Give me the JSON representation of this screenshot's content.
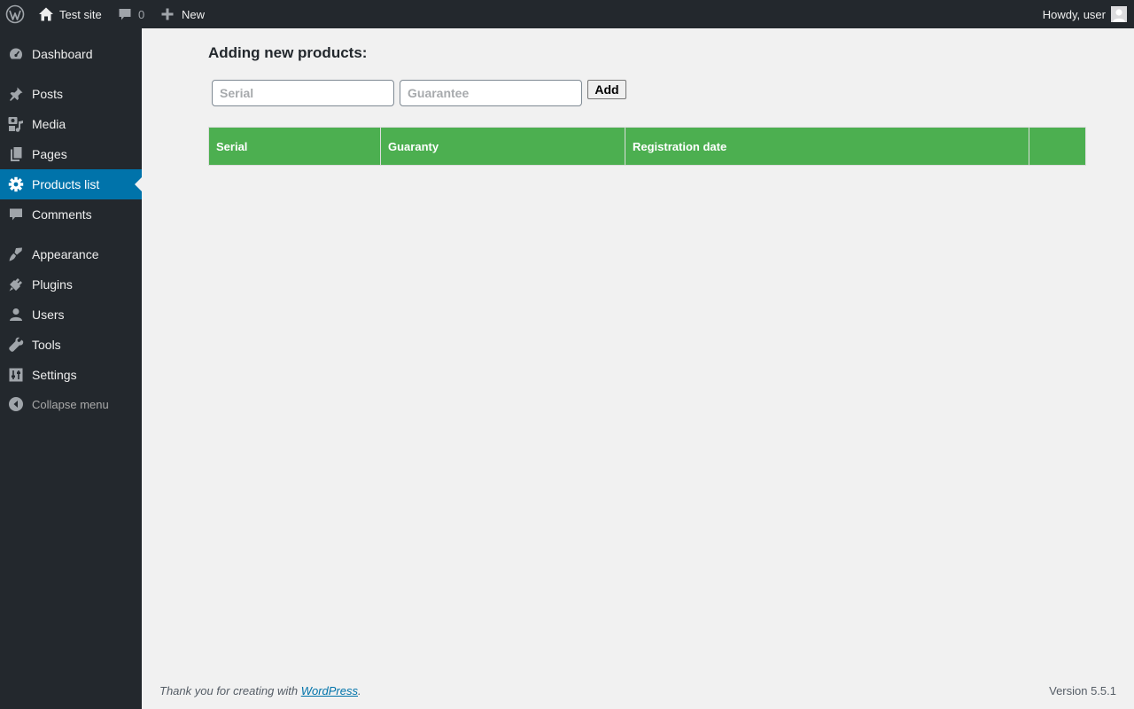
{
  "admin_bar": {
    "site_name": "Test site",
    "comments_count": "0",
    "new_label": "New",
    "howdy": "Howdy, user"
  },
  "sidebar": {
    "items": [
      {
        "label": "Dashboard",
        "icon": "dashboard-icon"
      },
      {
        "label": "Posts",
        "icon": "pin-icon"
      },
      {
        "label": "Media",
        "icon": "media-icon"
      },
      {
        "label": "Pages",
        "icon": "pages-icon"
      },
      {
        "label": "Products list",
        "icon": "gear-icon",
        "current": true
      },
      {
        "label": "Comments",
        "icon": "comment-icon"
      },
      {
        "label": "Appearance",
        "icon": "brush-icon"
      },
      {
        "label": "Plugins",
        "icon": "plug-icon"
      },
      {
        "label": "Users",
        "icon": "user-icon"
      },
      {
        "label": "Tools",
        "icon": "wrench-icon"
      },
      {
        "label": "Settings",
        "icon": "sliders-icon"
      }
    ],
    "collapse_label": "Collapse menu"
  },
  "main": {
    "title": "Adding new products:",
    "serial_placeholder": "Serial",
    "guarantee_placeholder": "Guarantee",
    "add_label": "Add",
    "table": {
      "headers": [
        "Serial",
        "Guaranty",
        "Registration date",
        ""
      ],
      "header_color": "#4caf50"
    }
  },
  "footer": {
    "thanks_prefix": "Thank you for creating with ",
    "link_text": "WordPress",
    "thanks_suffix": ".",
    "version": "Version 5.5.1"
  },
  "colors": {
    "admin_dark": "#23282d",
    "accent": "#0073aa",
    "background": "#f1f1f1"
  }
}
